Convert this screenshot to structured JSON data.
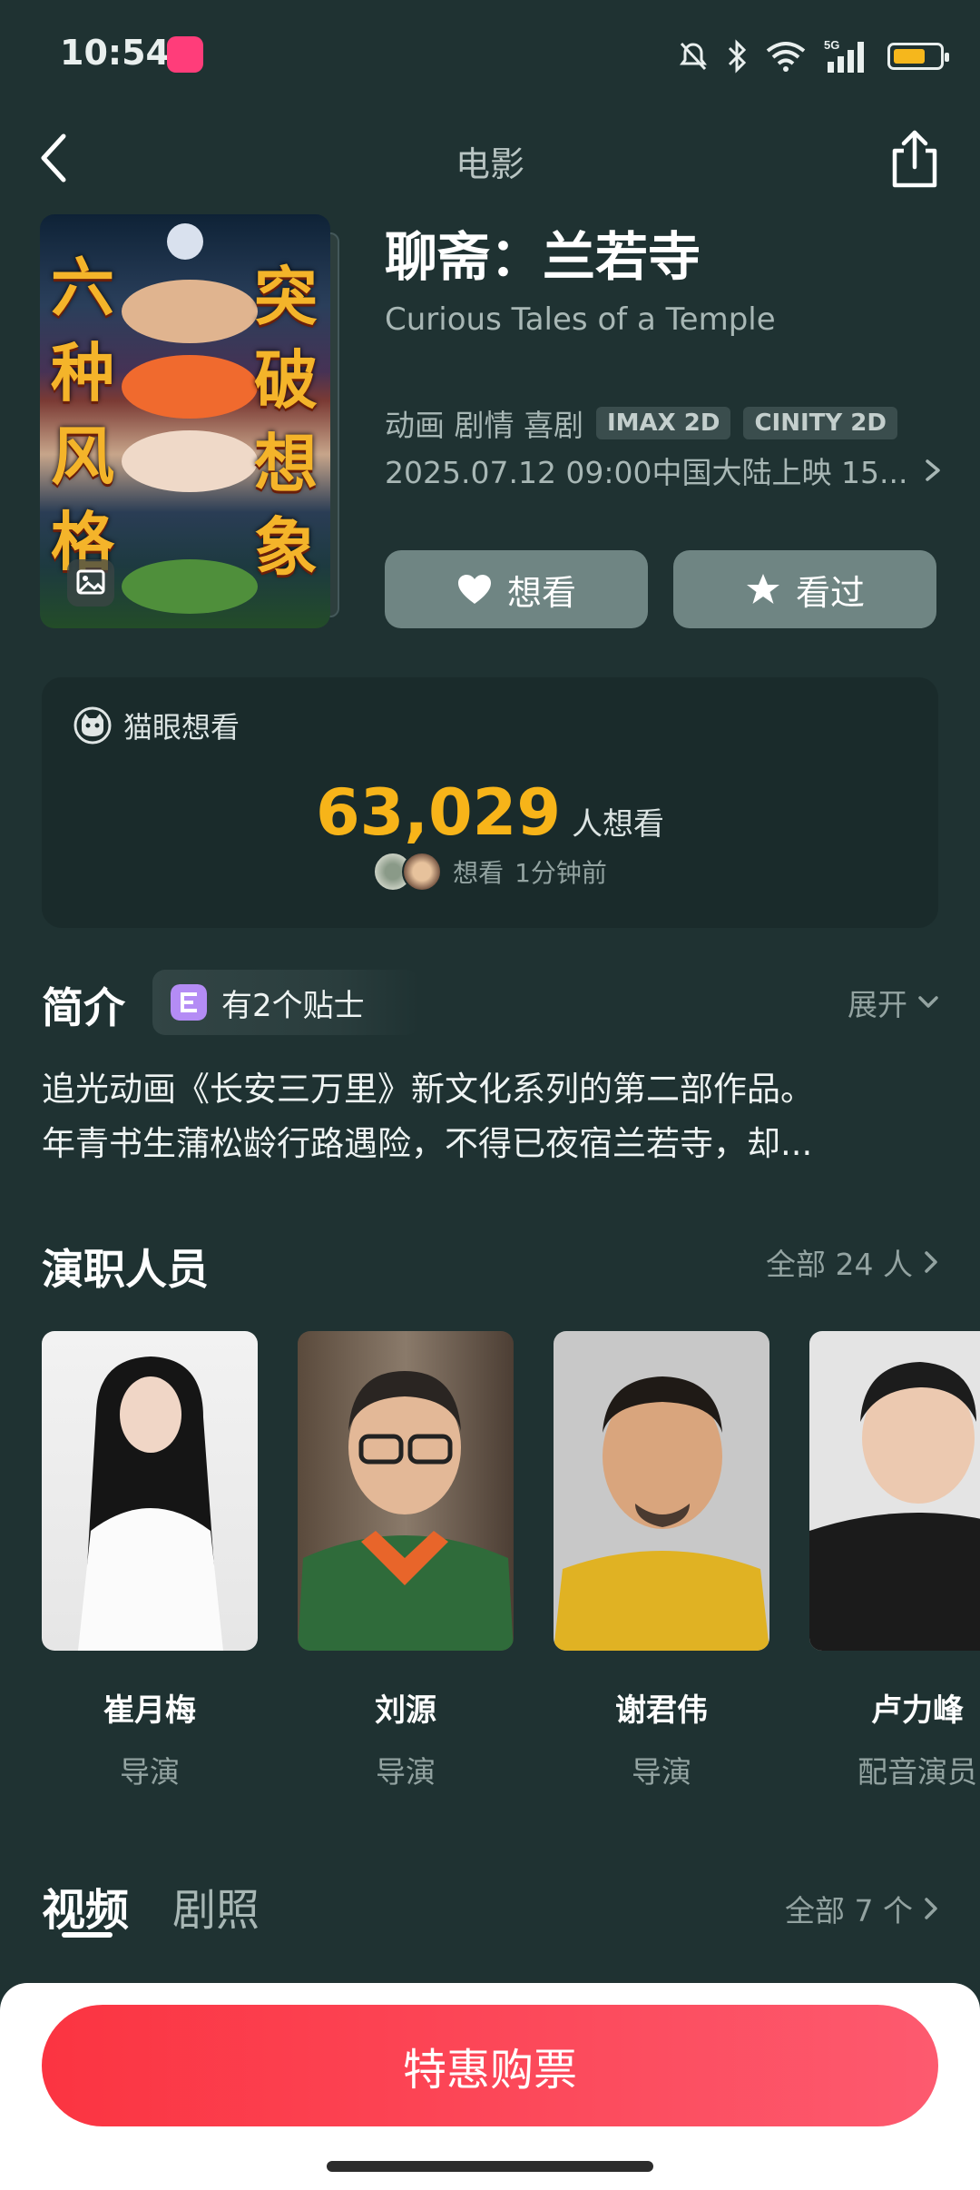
{
  "status_bar": {
    "time": "10:54",
    "icons": [
      "mute-icon",
      "bluetooth-icon",
      "wifi-icon",
      "signal-5g-icon",
      "battery-icon"
    ],
    "battery_level": 0.7,
    "battery_color": "#f6b71c"
  },
  "header": {
    "title": "电影",
    "back_icon": "chevron-left-icon",
    "share_icon": "share-icon"
  },
  "poster": {
    "left_chars": [
      "六",
      "种",
      "风",
      "格"
    ],
    "right_chars": [
      "突",
      "破",
      "想",
      "象"
    ],
    "gallery_icon": "image-icon"
  },
  "movie": {
    "title": "聊斋：兰若寺",
    "title_en": "Curious Tales of a Temple",
    "genres": "动画 剧情 喜剧",
    "tags": [
      "IMAX 2D",
      "CINITY 2D"
    ],
    "release": "2025.07.12 09:00中国大陆上映 15..."
  },
  "actions": {
    "want_label": "想看",
    "seen_label": "看过"
  },
  "want_card": {
    "label": "猫眼想看",
    "count": "63,029",
    "unit": "人想看",
    "recent_action": "想看",
    "recent_time": "1分钟前",
    "count_color": "#f7b419"
  },
  "intro": {
    "title": "简介",
    "tips": "有2个贴士",
    "expand": "展开",
    "line1": "追光动画《长安三万里》新文化系列的第二部作品。",
    "line2": "年青书生蒲松龄行路遇险，不得已夜宿兰若寺，却..."
  },
  "cast": {
    "title": "演职人员",
    "all": "全部 24 人",
    "members": [
      {
        "name": "崔月梅",
        "role": "导演"
      },
      {
        "name": "刘源",
        "role": "导演"
      },
      {
        "name": "谢君伟",
        "role": "导演"
      },
      {
        "name": "卢力峰",
        "role": "配音演员"
      }
    ]
  },
  "media": {
    "tab_video": "视频",
    "tab_photos": "剧照",
    "all": "全部 7 个"
  },
  "buy": {
    "label": "特惠购票",
    "color": "#fb3441"
  }
}
